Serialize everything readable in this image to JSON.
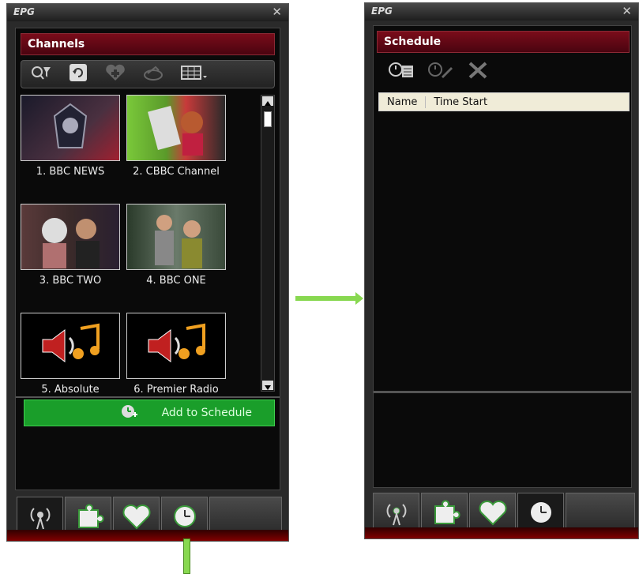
{
  "left_window": {
    "title": "EPG",
    "close": "✕",
    "section_title": "Channels",
    "toolbar": {
      "search_icon": "search-filter-icon",
      "refresh_icon": "refresh-icon",
      "add_favorite_icon": "add-favorite-icon",
      "disabled_icon": "scan-icon",
      "view_icon": "grid-view-icon"
    },
    "channels": [
      {
        "label": "1. BBC NEWS"
      },
      {
        "label": "2. CBBC Channel"
      },
      {
        "label": "3. BBC TWO"
      },
      {
        "label": "4. BBC ONE"
      },
      {
        "label": "5. Absolute"
      },
      {
        "label": "6. Premier Radio"
      }
    ],
    "add_to_schedule": "Add to Schedule"
  },
  "right_window": {
    "title": "EPG",
    "close": "✕",
    "section_title": "Schedule",
    "table": {
      "columns": [
        "Name",
        "Time Start"
      ]
    }
  },
  "tabs": [
    "broadcast-tab",
    "plugins-tab",
    "favorites-tab",
    "schedule-tab"
  ],
  "colors": {
    "accent_green": "#1a9e2a",
    "header_red": "#7a0c1a",
    "arrow_green": "#88d850"
  }
}
